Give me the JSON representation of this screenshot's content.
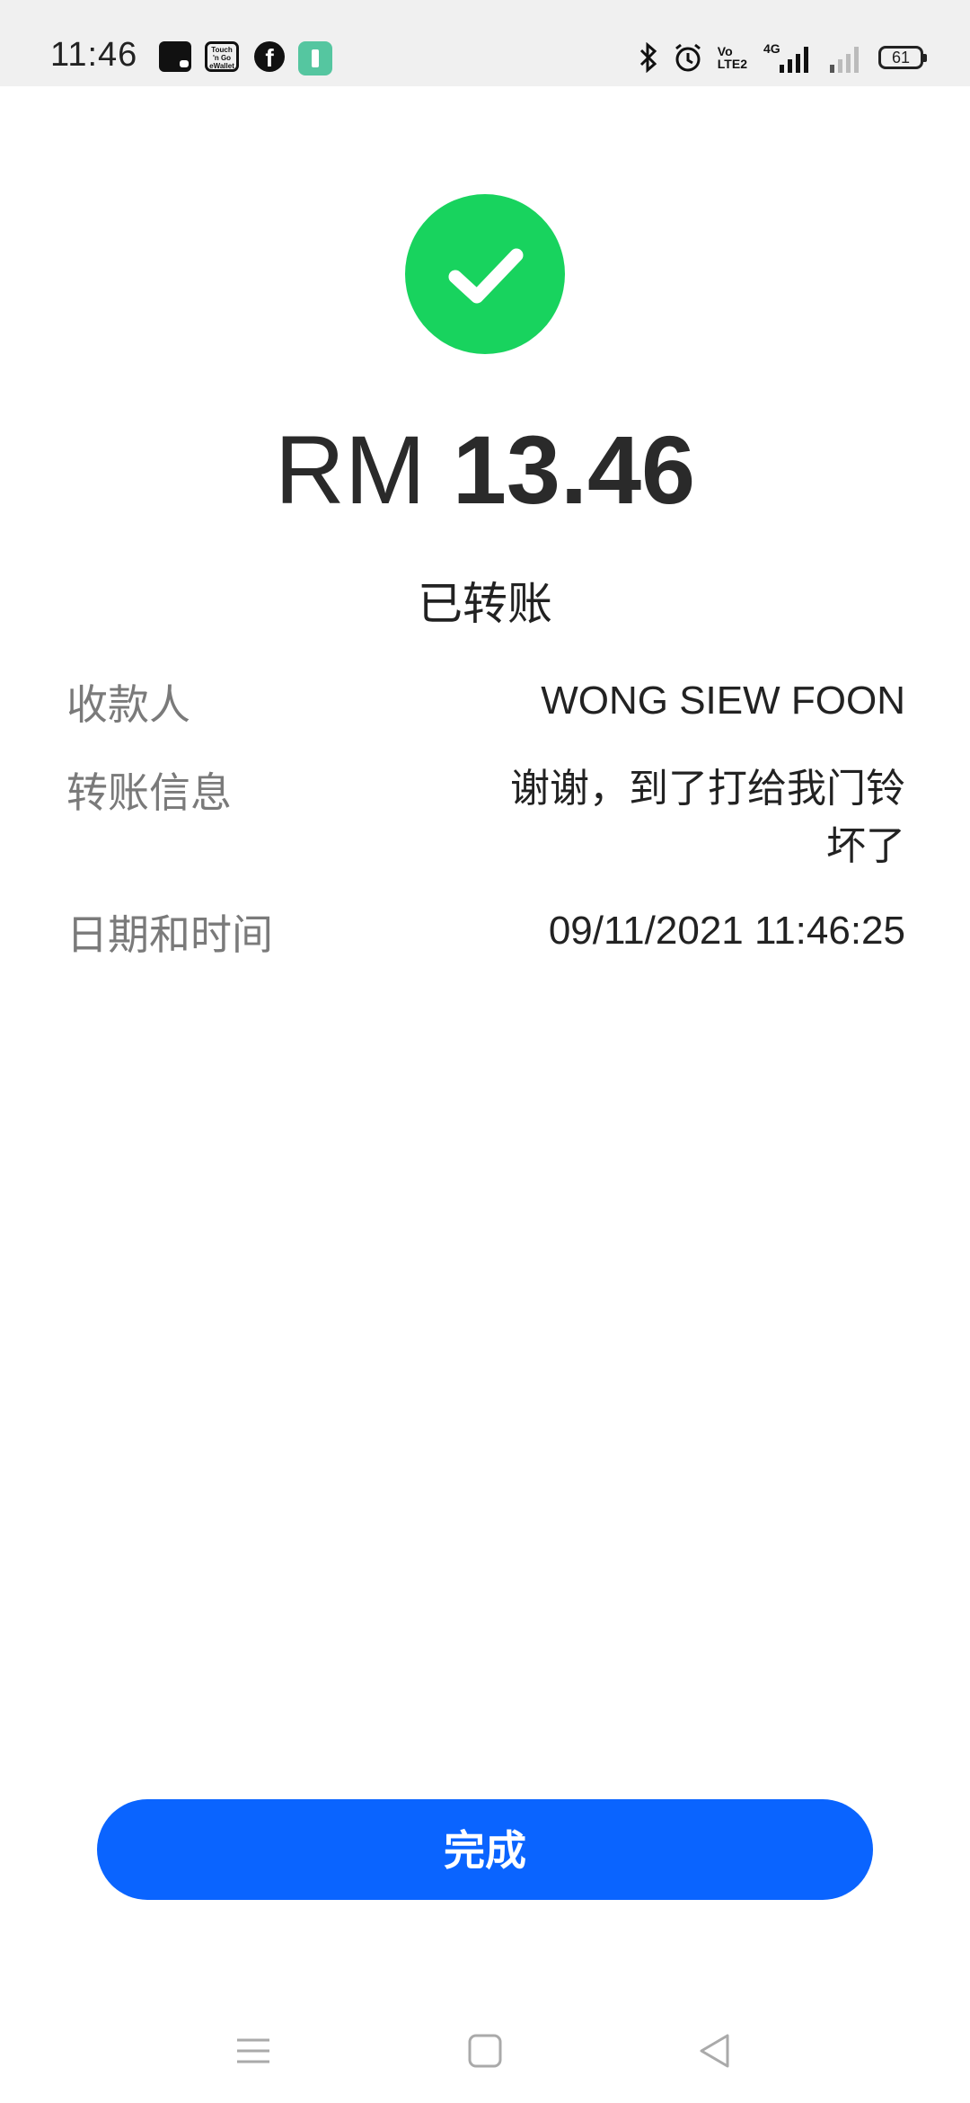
{
  "status_bar": {
    "time": "11:46",
    "notifications": [
      "wallet-icon",
      "touch-n-go-icon",
      "facebook-icon",
      "app-icon"
    ],
    "tng_label": "Touch 'n Go eWallet",
    "fb_glyph": "f",
    "volte_label_top": "Vo",
    "volte_label_bottom": "LTE2",
    "network_label": "4G",
    "battery_level": "61"
  },
  "receipt": {
    "currency": "RM",
    "amount": "13.46",
    "status": "已转账",
    "details": [
      {
        "label": "收款人",
        "value": "WONG SIEW FOON"
      },
      {
        "label": "转账信息",
        "value": "谢谢，到了打给我门铃坏了"
      },
      {
        "label": "日期和时间",
        "value": "09/11/2021 11:46:25"
      }
    ]
  },
  "actions": {
    "done_label": "完成"
  },
  "colors": {
    "success": "#18d35e",
    "primary": "#0a64ff"
  }
}
